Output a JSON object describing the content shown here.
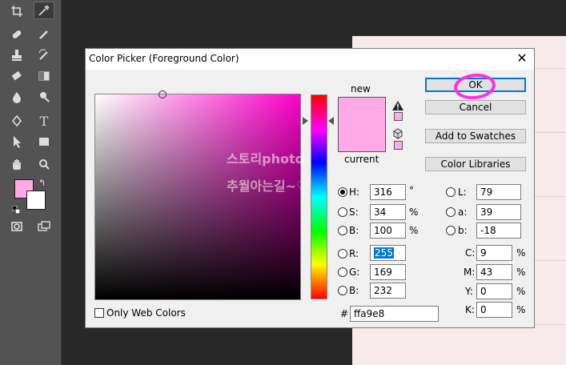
{
  "toolbar": {
    "tools": [
      "crop-icon",
      "eyedropper-icon",
      "healing-brush-icon",
      "brush-icon",
      "clone-stamp-icon",
      "history-brush-icon",
      "eraser-icon",
      "gradient-icon",
      "blur-icon",
      "dodge-icon",
      "pen-icon",
      "type-icon",
      "path-selection-icon",
      "rectangle-icon",
      "hand-icon",
      "zoom-icon",
      "quick-mask-icon",
      "screen-mode-icon"
    ],
    "foreground_color": "#ffa9e8",
    "background_color": "#ffffff"
  },
  "dialog": {
    "title": "Color Picker (Foreground Color)",
    "close": "✕",
    "new_label": "new",
    "current_label": "current",
    "new_color": "#ffa9e8",
    "current_color": "#ffa9e8",
    "buttons": {
      "ok": "OK",
      "cancel": "Cancel",
      "add_to_swatches": "Add to Swatches",
      "color_libraries": "Color Libraries"
    },
    "hsb": {
      "h_label": "H:",
      "h_value": "316",
      "h_unit": "°",
      "s_label": "S:",
      "s_value": "34",
      "s_unit": "%",
      "b_label": "B:",
      "b_value": "100",
      "b_unit": "%"
    },
    "rgb": {
      "r_label": "R:",
      "r_value": "255",
      "g_label": "G:",
      "g_value": "169",
      "b_label": "B:",
      "b_value": "232"
    },
    "lab": {
      "l_label": "L:",
      "l_value": "79",
      "a_label": "a:",
      "a_value": "39",
      "b_label": "b:",
      "b_value": "-18"
    },
    "cmyk": {
      "c_label": "C:",
      "c_value": "9",
      "c_unit": "%",
      "m_label": "M:",
      "m_value": "43",
      "m_unit": "%",
      "y_label": "Y:",
      "y_value": "0",
      "y_unit": "%",
      "k_label": "K:",
      "k_value": "0",
      "k_unit": "%"
    },
    "hex_label": "#",
    "hex_value": "ffa9e8",
    "only_web_colors": "Only Web Colors",
    "watermark_line1": "스토리photo",
    "watermark_line2": "추월아는길~♡"
  }
}
